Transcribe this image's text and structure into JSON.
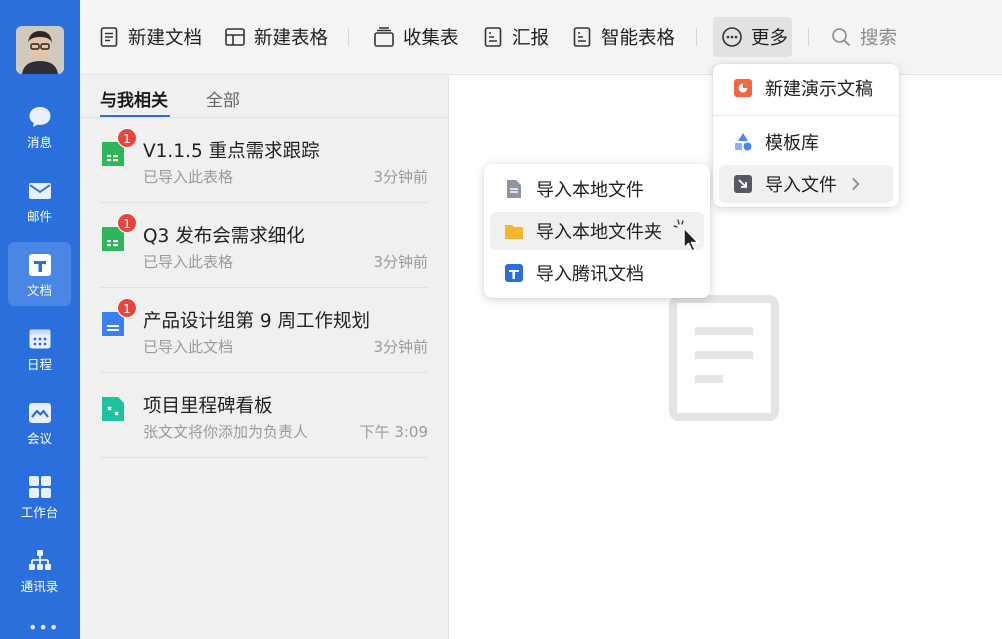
{
  "toolbar": {
    "new_doc": "新建文档",
    "new_sheet": "新建表格",
    "collect": "收集表",
    "report": "汇报",
    "smart_sheet": "智能表格",
    "more": "更多",
    "search": "搜索"
  },
  "sidebar": {
    "items": [
      {
        "label": "消息",
        "icon": "message-icon"
      },
      {
        "label": "邮件",
        "icon": "mail-icon"
      },
      {
        "label": "文档",
        "icon": "docs-icon",
        "active": true
      },
      {
        "label": "日程",
        "icon": "calendar-icon"
      },
      {
        "label": "会议",
        "icon": "meeting-icon"
      },
      {
        "label": "工作台",
        "icon": "workbench-icon"
      },
      {
        "label": "通讯录",
        "icon": "contacts-icon"
      }
    ],
    "more": "•••"
  },
  "tabs": {
    "related": "与我相关",
    "all": "全部"
  },
  "docs": [
    {
      "title": "V1.1.5 重点需求跟踪",
      "sub": "已导入此表格",
      "time": "3分钟前",
      "badge": "1",
      "icon": "sheet-file-icon"
    },
    {
      "title": "Q3 发布会需求细化",
      "sub": "已导入此表格",
      "time": "3分钟前",
      "badge": "1",
      "icon": "sheet-file-icon"
    },
    {
      "title": "产品设计组第 9 周工作规划",
      "sub": "已导入此文档",
      "time": "3分钟前",
      "badge": "1",
      "icon": "doc-file-icon"
    },
    {
      "title": "项目里程碑看板",
      "sub": "张文文将你添加为负责人",
      "time": "下午 3:09",
      "badge": "",
      "icon": "board-file-icon"
    }
  ],
  "more_menu": {
    "new_slides": "新建演示文稿",
    "templates": "模板库",
    "import_file": "导入文件"
  },
  "import_menu": {
    "local_file": "导入本地文件",
    "local_folder": "导入本地文件夹",
    "tencent_doc": "导入腾讯文档"
  },
  "colors": {
    "brand_blue": "#2a6fdc",
    "badge_red": "#e8453c",
    "sheet_green": "#2fb65b",
    "doc_blue": "#3d7ef0",
    "slides_orange": "#f2673b",
    "folder_yellow": "#f7b52c"
  }
}
